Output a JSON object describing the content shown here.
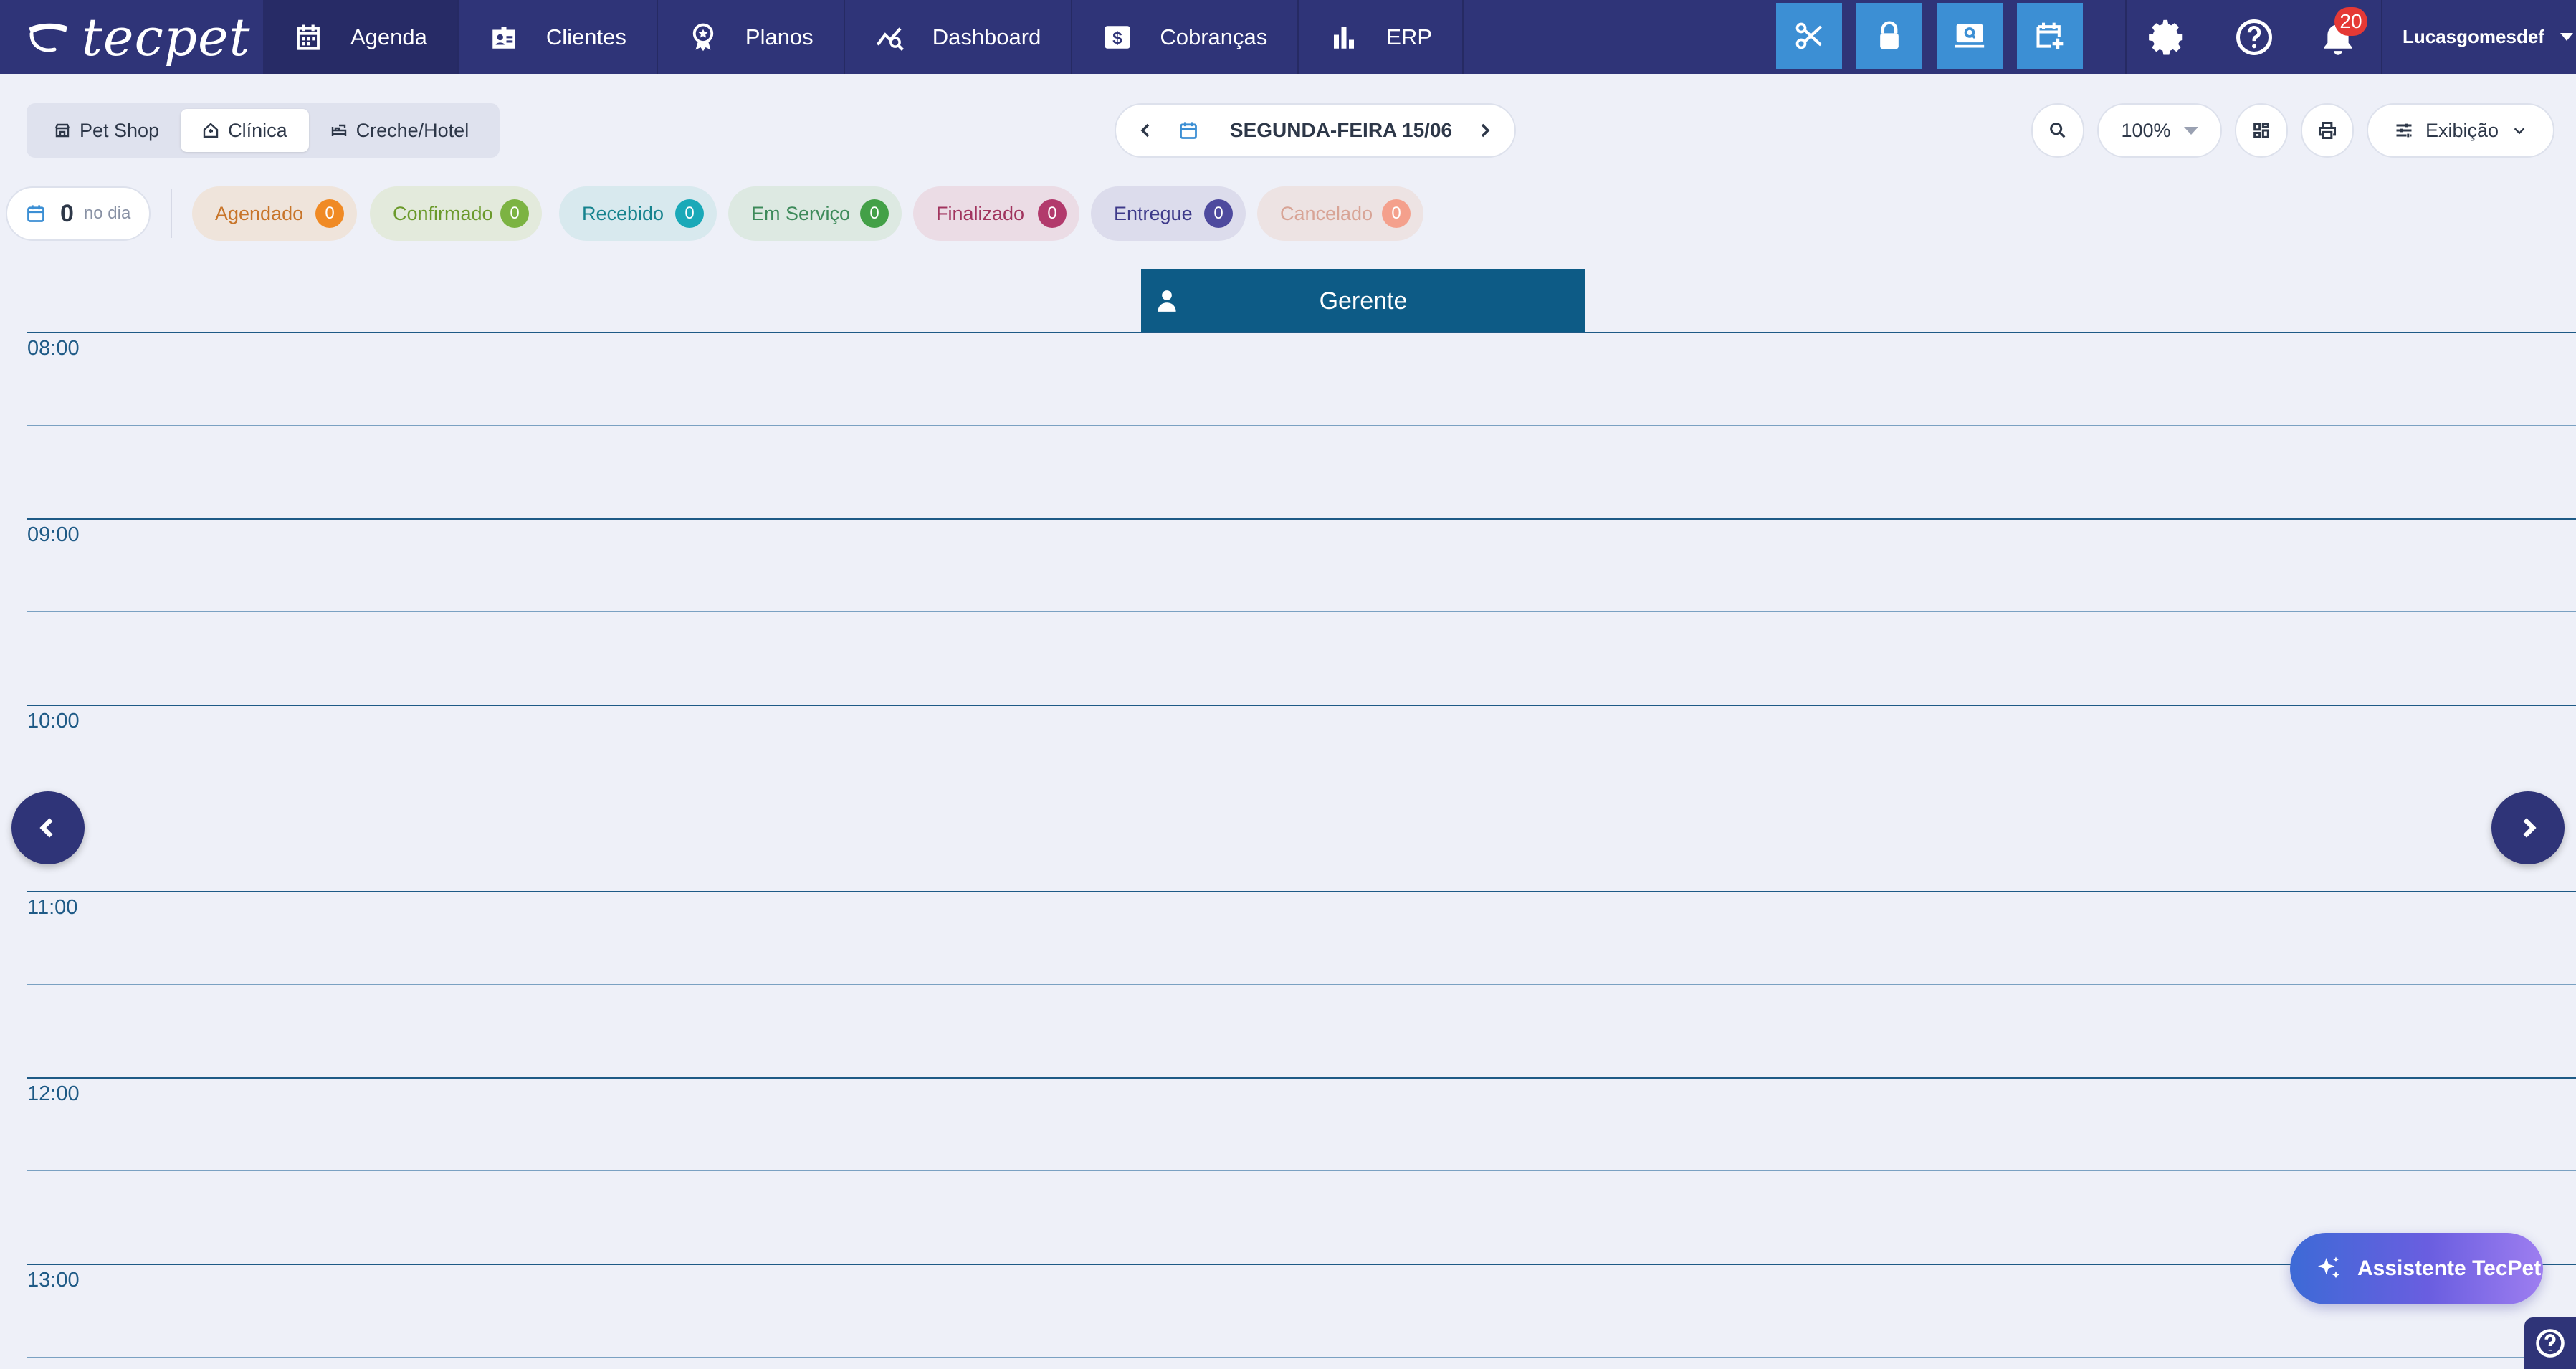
{
  "brand": {
    "name": "tecpet"
  },
  "nav": {
    "items": [
      {
        "label": "Agenda",
        "icon": "calendar-icon"
      },
      {
        "label": "Clientes",
        "icon": "id-badge-icon"
      },
      {
        "label": "Planos",
        "icon": "award-icon"
      },
      {
        "label": "Dashboard",
        "icon": "chart-line-icon"
      },
      {
        "label": "Cobranças",
        "icon": "dollar-icon"
      },
      {
        "label": "ERP",
        "icon": "bar-chart-icon"
      }
    ],
    "quick_actions": [
      "scissors-icon",
      "lock-icon",
      "screen-search-icon",
      "calendar-add-icon"
    ],
    "notifications_count": "20",
    "username": "Lucasgomesdef"
  },
  "segments": {
    "pet_shop": "Pet Shop",
    "clinica": "Clínica",
    "creche": "Creche/Hotel",
    "active": "Clínica"
  },
  "date": {
    "label": "SEGUNDA-FEIRA 15/06"
  },
  "toolbar": {
    "zoom": "100%",
    "exibicao": "Exibição"
  },
  "day_summary": {
    "count": "0",
    "label": "no dia"
  },
  "statuses": [
    {
      "label": "Agendado",
      "count": "0",
      "text": "#c8752a",
      "bg": "#efe4db",
      "badge": "#f08a24"
    },
    {
      "label": "Confirmado",
      "count": "0",
      "text": "#6b9a2b",
      "bg": "#e3eadc",
      "badge": "#7cb342"
    },
    {
      "label": "Recebido",
      "count": "0",
      "text": "#16838e",
      "bg": "#d8e9ee",
      "badge": "#1aa9b8"
    },
    {
      "label": "Em Serviço",
      "count": "0",
      "text": "#3d8a5a",
      "bg": "#dde9e2",
      "badge": "#43a047"
    },
    {
      "label": "Finalizado",
      "count": "0",
      "text": "#a1345e",
      "bg": "#ebdce5",
      "badge": "#b23a6c"
    },
    {
      "label": "Entregue",
      "count": "0",
      "text": "#3e3a8a",
      "bg": "#dcdcec",
      "badge": "#4e4a9e"
    },
    {
      "label": "Cancelado",
      "count": "0",
      "text": "#d8a496",
      "bg": "#ede3e3",
      "badge": "#f4a08c"
    }
  ],
  "calendar": {
    "column": "Gerente",
    "hours": [
      "08:00",
      "09:00",
      "10:00",
      "11:00",
      "12:00",
      "13:00"
    ]
  },
  "assistant": {
    "label": "Assistente TecPet"
  }
}
